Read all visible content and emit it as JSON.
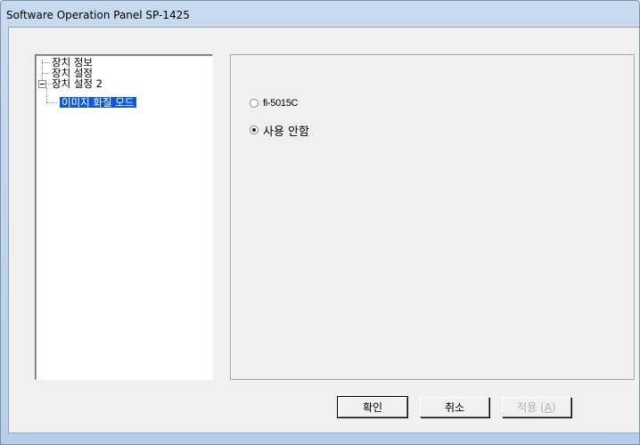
{
  "window": {
    "title": "Software Operation Panel SP-1425"
  },
  "tree": {
    "items": [
      {
        "label": "장치 정보"
      },
      {
        "label": "장치 설정"
      },
      {
        "label": "장치 설정 2"
      },
      {
        "label": "이미지 화질 모드",
        "selected": true
      }
    ]
  },
  "options": {
    "items": [
      {
        "label": "fi-5015C",
        "checked": false
      },
      {
        "label": "사용 안함",
        "checked": true
      }
    ]
  },
  "buttons": {
    "ok": "확인",
    "cancel": "취소",
    "apply_prefix": "적용 (",
    "apply_accel": "A",
    "apply_suffix": ")",
    "apply_enabled": false
  },
  "colors": {
    "selection": "#1057d8",
    "titlebar": "#c9daf0"
  }
}
